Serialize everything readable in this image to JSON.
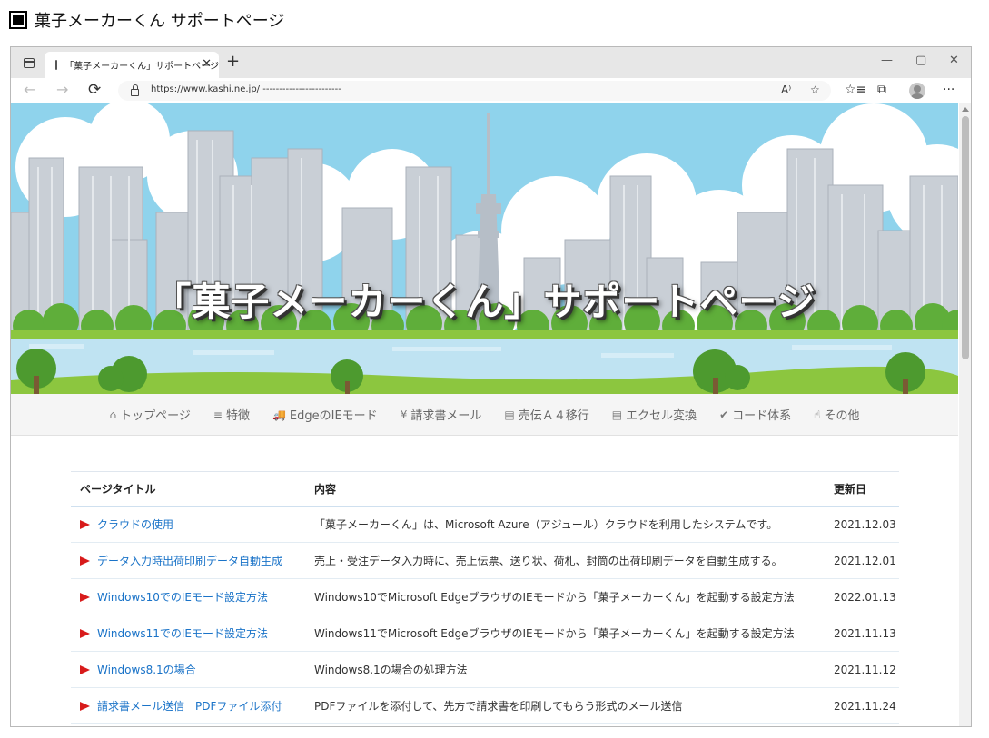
{
  "heading": {
    "text": "菓子メーカーくん サポートページ"
  },
  "browser": {
    "tab_title": "「菓子メーカーくん」サポートページ",
    "url": "https://www.kashi.ne.jp/ ------------------------",
    "icons": {
      "tab_actions": "tab-actions-icon",
      "page": "page-icon",
      "close": "✕",
      "new_tab": "+",
      "back": "←",
      "forward": "→",
      "reload": "⟳",
      "read_aloud": "A⁾",
      "favorite": "☆",
      "favorites": "☆≡",
      "collections": "⧉",
      "more": "···",
      "minimize": "—",
      "maximize": "▢",
      "window_close": "✕"
    }
  },
  "hero": {
    "title": "「菓子メーカーくん」サポートページ"
  },
  "nav": {
    "items": [
      {
        "icon": "⌂",
        "label": "トップページ"
      },
      {
        "icon": "≡",
        "label": "特徴"
      },
      {
        "icon": "🚚",
        "label": "EdgeのIEモード"
      },
      {
        "icon": "¥",
        "label": "請求書メール"
      },
      {
        "icon": "▤",
        "label": "売伝Ａ４移行"
      },
      {
        "icon": "▤",
        "label": "エクセル変換"
      },
      {
        "icon": "✔",
        "label": "コード体系"
      },
      {
        "icon": "☝",
        "label": "その他"
      }
    ]
  },
  "table": {
    "headers": [
      "ページタイトル",
      "内容",
      "更新日"
    ],
    "rows": [
      {
        "title": "クラウドの使用",
        "content": "「菓子メーカーくん」は、Microsoft Azure（アジュール）クラウドを利用したシステムです。",
        "date": "2021.12.03"
      },
      {
        "title": "データ入力時出荷印刷データ自動生成",
        "content": "売上・受注データ入力時に、売上伝票、送り状、荷札、封筒の出荷印刷データを自動生成する。",
        "date": "2021.12.01"
      },
      {
        "title": "Windows10でのIEモード設定方法",
        "content": "Windows10でMicrosoft EdgeブラウザのIEモードから「菓子メーカーくん」を起動する設定方法",
        "date": "2022.01.13"
      },
      {
        "title": "Windows11でのIEモード設定方法",
        "content": "Windows11でMicrosoft EdgeブラウザのIEモードから「菓子メーカーくん」を起動する設定方法",
        "date": "2021.11.13"
      },
      {
        "title": "Windows8.1の場合",
        "content": "Windows8.1の場合の処理方法",
        "date": "2021.11.12"
      },
      {
        "title": "請求書メール送信　PDFファイル添付",
        "content": "PDFファイルを添付して、先方で請求書を印刷してもらう形式のメール送信",
        "date": "2021.11.24"
      }
    ]
  },
  "colors": {
    "sky": "#8fd3ec",
    "cloud": "#ffffff",
    "building": "#c9cfd6",
    "tree": "#5fae3a",
    "grass": "#8cc63f",
    "water": "#bfe3f2",
    "link": "#1a73c8",
    "arrow": "#d81b1b"
  }
}
